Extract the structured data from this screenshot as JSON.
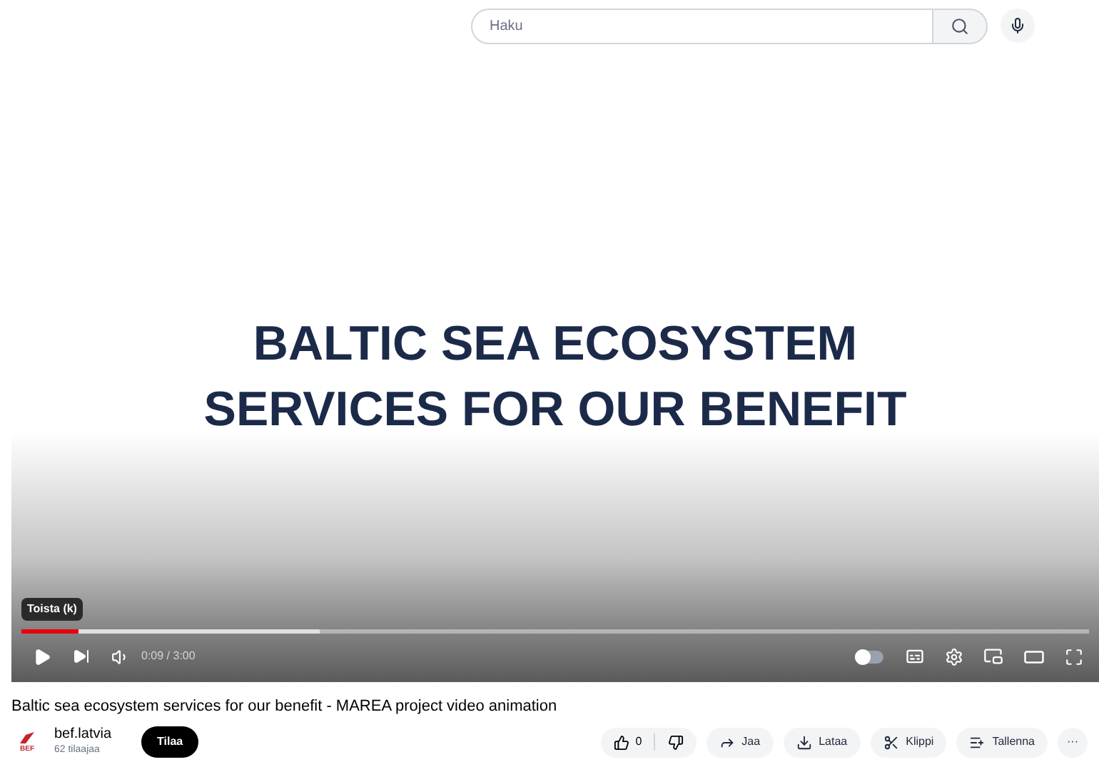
{
  "search": {
    "placeholder": "Haku"
  },
  "video": {
    "caption_lines": [
      "BALTIC SEA ECOSYSTEM",
      "SERVICES FOR OUR BENEFIT"
    ],
    "tooltip": "Toista (k)",
    "progress": {
      "level": 0.053
    },
    "buffered": {
      "level": 0.28
    },
    "time": "0:09 / 3:00",
    "autoplay": {
      "on": false
    }
  },
  "title": "Baltic sea ecosystem services for our benefit - MAREA project video animation",
  "channel": {
    "logo_text": "BEF",
    "name": "bef.latvia",
    "subscribers": "62 tilaajaa",
    "subscribe": "Tilaa"
  },
  "actions": {
    "likes": "0",
    "buttons": [
      {
        "kind": "share",
        "label": "Jaa"
      },
      {
        "kind": "download",
        "label": "Lataa"
      },
      {
        "kind": "clip",
        "label": "Klippi"
      },
      {
        "kind": "save",
        "label": "Tallenna"
      }
    ],
    "more": "···"
  }
}
